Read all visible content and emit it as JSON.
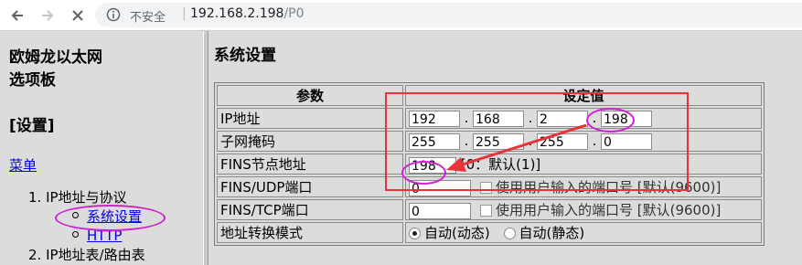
{
  "browser": {
    "security_label": "不安全",
    "url_host": "192.168.2.198",
    "url_path": "/P0"
  },
  "left_panel": {
    "title_line1": "欧姆龙以太网",
    "title_line2": "选项板",
    "section_heading": "[设置]",
    "menu_link": "菜单",
    "items": [
      {
        "label": "1. IP地址与协议"
      },
      {
        "label": "系统设置"
      },
      {
        "label": "HTTP"
      },
      {
        "label": "2. IP地址表/路由表"
      }
    ]
  },
  "main": {
    "title": "系统设置",
    "headers": {
      "param": "参数",
      "value": "设定值"
    },
    "rows": {
      "ip": {
        "label": "IP地址",
        "octets": [
          "192",
          "168",
          "2",
          "198"
        ]
      },
      "subnet": {
        "label": "子网掩码",
        "octets": [
          "255",
          "255",
          "255",
          "0"
        ]
      },
      "fins_node": {
        "label": "FINS节点地址",
        "value": "198",
        "hint": "[0：默认(1)]"
      },
      "fins_udp": {
        "label": "FINS/UDP端口",
        "value": "0",
        "checkbox_label": "使用用户输入的端口号 [默认(9600)]"
      },
      "fins_tcp": {
        "label": "FINS/TCP端口",
        "value": "0",
        "checkbox_label": "使用用户输入的端口号 [默认(9600)]"
      },
      "addr_mode": {
        "label": "地址转换模式",
        "option_dynamic": "自动(动态)",
        "option_static": "自动(静态)",
        "selected": "自动(动态)"
      }
    }
  },
  "colors": {
    "annotation_rect": "#e8333a",
    "annotation_ellipse": "#d21fd2",
    "link": "#0000ee",
    "background": "#dcdcdc"
  }
}
